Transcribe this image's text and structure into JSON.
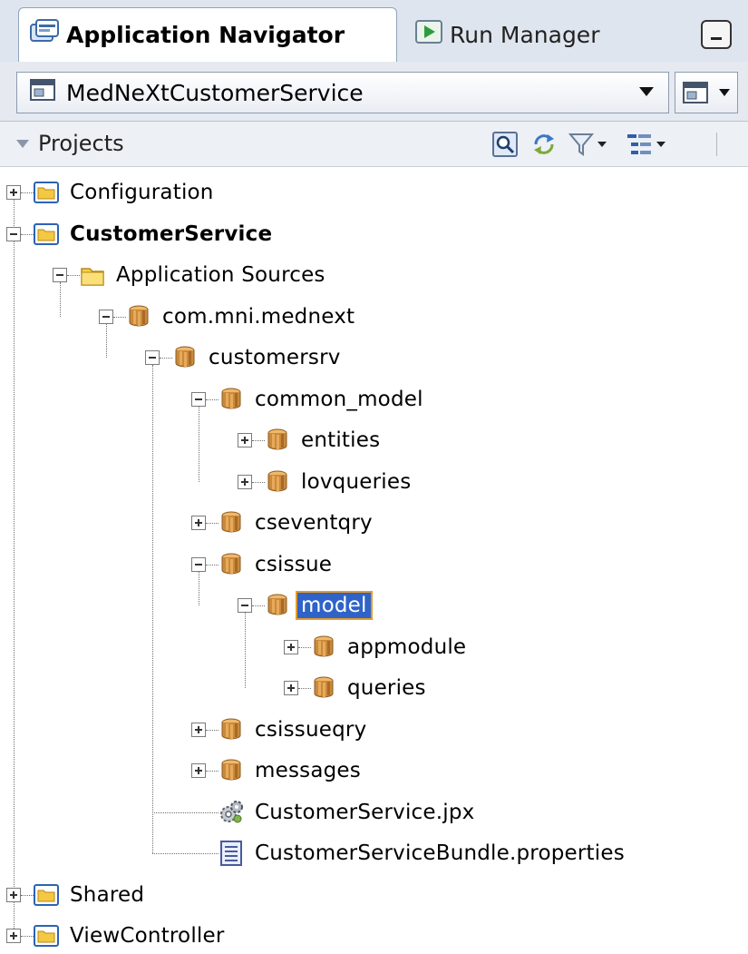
{
  "tabs": {
    "active": {
      "label": "Application Navigator",
      "icon": "application-navigator-icon"
    },
    "inactive": {
      "label": "Run Manager",
      "icon": "run-icon"
    },
    "minimize": "minimize-icon"
  },
  "app": {
    "name": "MedNeXtCustomerService",
    "icon": "application-icon"
  },
  "projects": {
    "label": "Projects",
    "tools": [
      "search-icon",
      "refresh-icon",
      "filter-icon",
      "working-sets-icon"
    ]
  },
  "tree": [
    {
      "label": "Configuration",
      "icon": "project-folder",
      "level": 0,
      "state": "collapsed"
    },
    {
      "label": "CustomerService",
      "icon": "project-folder",
      "level": 0,
      "state": "expanded",
      "bold": true
    },
    {
      "label": "Application Sources",
      "icon": "folder",
      "level": 1,
      "state": "expanded"
    },
    {
      "label": "com.mni.mednext",
      "icon": "package",
      "level": 2,
      "state": "expanded"
    },
    {
      "label": "customersrv",
      "icon": "package",
      "level": 3,
      "state": "expanded"
    },
    {
      "label": "common_model",
      "icon": "package",
      "level": 4,
      "state": "expanded"
    },
    {
      "label": "entities",
      "icon": "package",
      "level": 5,
      "state": "collapsed"
    },
    {
      "label": "lovqueries",
      "icon": "package",
      "level": 5,
      "state": "collapsed"
    },
    {
      "label": "cseventqry",
      "icon": "package",
      "level": 4,
      "state": "collapsed"
    },
    {
      "label": "csissue",
      "icon": "package",
      "level": 4,
      "state": "expanded"
    },
    {
      "label": "model",
      "icon": "package",
      "level": 5,
      "state": "expanded",
      "selected": true
    },
    {
      "label": "appmodule",
      "icon": "package",
      "level": 6,
      "state": "collapsed"
    },
    {
      "label": "queries",
      "icon": "package",
      "level": 6,
      "state": "collapsed"
    },
    {
      "label": "csissueqry",
      "icon": "package",
      "level": 4,
      "state": "collapsed"
    },
    {
      "label": "messages",
      "icon": "package",
      "level": 4,
      "state": "collapsed"
    },
    {
      "label": "CustomerService.jpx",
      "icon": "jpx-file",
      "level": 4,
      "state": "leaf"
    },
    {
      "label": "CustomerServiceBundle.properties",
      "icon": "properties-file",
      "level": 4,
      "state": "leaf"
    },
    {
      "label": "Shared",
      "icon": "project-folder",
      "level": 0,
      "state": "collapsed"
    },
    {
      "label": "ViewController",
      "icon": "project-folder",
      "level": 0,
      "state": "collapsed"
    }
  ],
  "colors": {
    "selection": "#2f63c8",
    "selection_outline": "#e39b2b",
    "package": "#c98a3c",
    "folder": "#f2c94c"
  }
}
